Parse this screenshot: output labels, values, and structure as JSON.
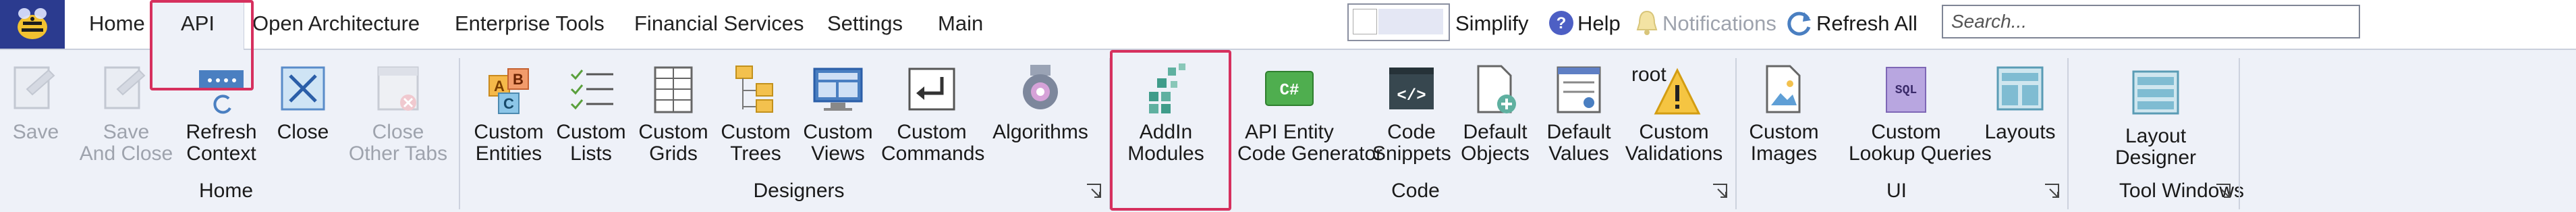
{
  "tabs": [
    "Home",
    "API",
    "Open Architecture",
    "Enterprise Tools",
    "Financial Services",
    "Settings",
    "Main"
  ],
  "active_tab": "API",
  "toolbar": {
    "simplify": "Simplify",
    "help": "Help",
    "notifications": "Notifications",
    "refresh_all": "Refresh All",
    "search_placeholder": "Search..."
  },
  "groups": {
    "home": {
      "label": "Home",
      "buttons": [
        {
          "l1": "Save",
          "l2": ""
        },
        {
          "l1": "Save",
          "l2": "And Close"
        },
        {
          "l1": "Refresh",
          "l2": "Context"
        },
        {
          "l1": "Close",
          "l2": ""
        },
        {
          "l1": "Close",
          "l2": "Other Tabs"
        }
      ]
    },
    "designers": {
      "label": "Designers",
      "buttons": [
        {
          "l1": "Custom",
          "l2": "Entities"
        },
        {
          "l1": "Custom",
          "l2": "Lists"
        },
        {
          "l1": "Custom",
          "l2": "Grids"
        },
        {
          "l1": "Custom",
          "l2": "Trees"
        },
        {
          "l1": "Custom",
          "l2": "Views"
        },
        {
          "l1": "Custom",
          "l2": "Commands"
        },
        {
          "l1": "Algorithms",
          "l2": ""
        }
      ]
    },
    "code": {
      "label": "Code",
      "buttons": [
        {
          "l1": "AddIn",
          "l2": "Modules"
        },
        {
          "l1": "API Entity",
          "l2": "Code Generator"
        },
        {
          "l1": "Code",
          "l2": "Snippets"
        },
        {
          "l1": "Default",
          "l2": "Objects"
        },
        {
          "l1": "Default",
          "l2": "Values"
        },
        {
          "l1": "Custom",
          "l2": "Validations"
        }
      ],
      "root_text": "root"
    },
    "ui": {
      "label": "UI",
      "buttons": [
        {
          "l1": "Custom",
          "l2": "Images"
        },
        {
          "l1": "Custom",
          "l2": "Lookup Queries"
        },
        {
          "l1": "Layouts",
          "l2": ""
        }
      ]
    },
    "tool_windows": {
      "label": "Tool Windows",
      "buttons": [
        {
          "l1": "Layout",
          "l2": "Designer"
        }
      ]
    }
  },
  "colors": {
    "highlight": "#d6305e",
    "app_button": "#2b3b8f",
    "ribbon_bg": "#eef1f8"
  }
}
